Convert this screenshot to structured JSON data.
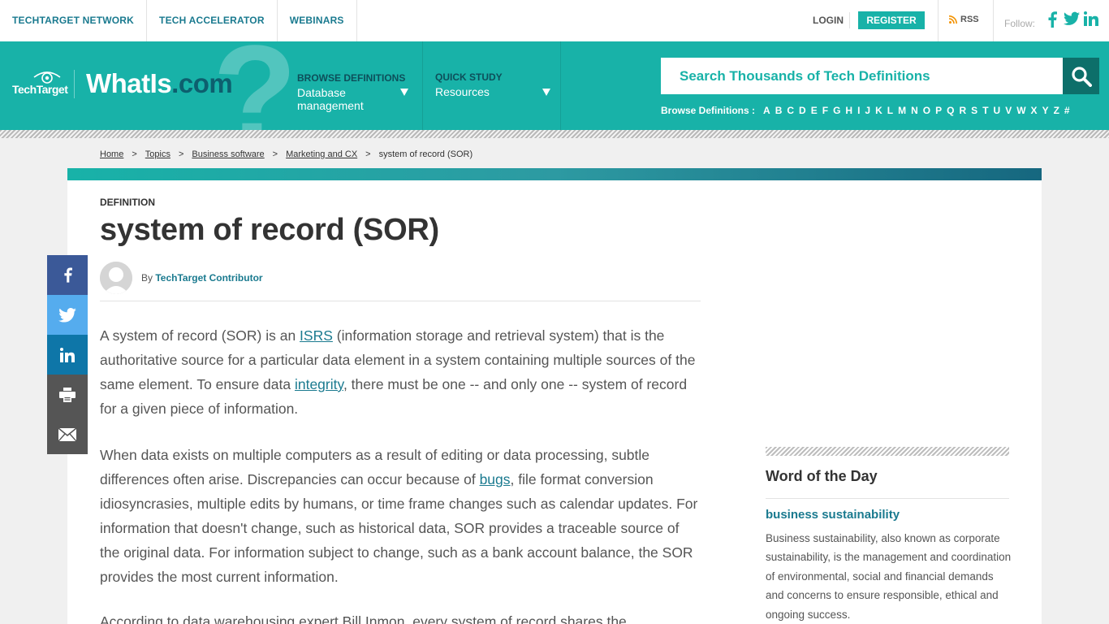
{
  "topbar": {
    "nav": [
      "TECHTARGET NETWORK",
      "TECH ACCELERATOR",
      "WEBINARS"
    ],
    "login": "LOGIN",
    "register": "REGISTER",
    "rss": "RSS",
    "follow": "Follow:"
  },
  "header": {
    "techtarget": "TechTarget",
    "site_name": "WhatIs",
    "site_suffix": ".com",
    "qmark": "?",
    "browse_label": "BROWSE DEFINITIONS",
    "browse_value": "Database management",
    "quick_label": "QUICK STUDY",
    "quick_value": "Resources",
    "search_placeholder": "Search Thousands of Tech Definitions",
    "browse_defs_label": "Browse Definitions :",
    "letters": [
      "A",
      "B",
      "C",
      "D",
      "E",
      "F",
      "G",
      "H",
      "I",
      "J",
      "K",
      "L",
      "M",
      "N",
      "O",
      "P",
      "Q",
      "R",
      "S",
      "T",
      "U",
      "V",
      "W",
      "X",
      "Y",
      "Z",
      "#"
    ]
  },
  "breadcrumb": [
    "Home",
    "Topics",
    "Business software",
    "Marketing and CX",
    "system of record (SOR)"
  ],
  "article": {
    "label": "DEFINITION",
    "title": "system of record (SOR)",
    "by": "By",
    "author": "TechTarget Contributor",
    "p1": {
      "a": "A system of record (SOR) is an ",
      "link1": "ISRS",
      "b": " (information storage and retrieval system) that is the authoritative source for a particular data element in a system containing multiple sources of the same element. To ensure data ",
      "link2": "integrity",
      "c": ", there must be one -- and only one -- system of record for a given piece of information."
    },
    "p2": {
      "a": "When data exists on multiple computers as a result of editing or data processing, subtle differences often arise. Discrepancies can occur because of ",
      "link1": "bugs",
      "b": ", file format conversion idiosyncrasies, multiple edits by humans, or time frame changes such as calendar updates. For information that doesn't change, such as historical data, SOR provides a traceable source of the original data. For information subject to change, such as a bank account balance, the SOR provides the most current information."
    },
    "p3": "According to data warehousing expert Bill Inmon, every system of record shares the"
  },
  "share": [
    {
      "name": "facebook-icon",
      "color": "#3b5998"
    },
    {
      "name": "twitter-icon",
      "color": "#55acee"
    },
    {
      "name": "linkedin-icon",
      "color": "#0e76a8"
    },
    {
      "name": "print-icon",
      "color": "#555555"
    },
    {
      "name": "email-icon",
      "color": "#555555"
    }
  ],
  "word_of_day": {
    "title": "Word of the Day",
    "term": "business sustainability",
    "description": "Business sustainability, also known as corporate sustainability, is the management and coordination of environmental, social and financial demands and concerns to ensure responsible, ethical and ongoing success."
  },
  "colors": {
    "brand": "#18b2a8",
    "link": "#1a7a8f"
  }
}
